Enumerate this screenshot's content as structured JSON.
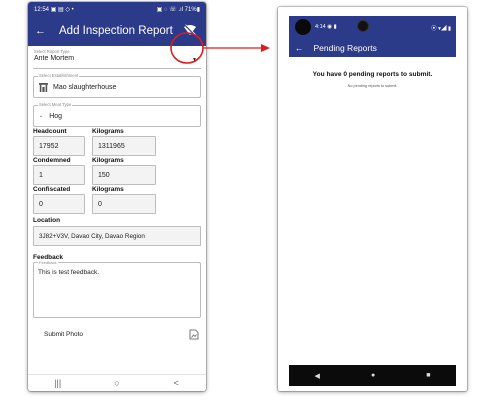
{
  "left_screen": {
    "status_bar": {
      "time": "12:54",
      "icons_left": "▣ ▤ ◇ •",
      "icons_right": "▣ ◌ ☏ .ıl 71%▮"
    },
    "app_bar": {
      "title": "Add Inspection Report",
      "back_icon": "arrow-left-icon",
      "action_icon": "wifi-off-icon"
    },
    "form": {
      "report_type": {
        "label": "Select Report Type",
        "value": "Ante Mortem"
      },
      "establishment": {
        "label": "Select Establishment",
        "value": "Mao slaughterhouse"
      },
      "meat_type": {
        "label": "Select Meat Type",
        "value": "Hog"
      },
      "headcount": {
        "label": "Headcount",
        "value": "17952",
        "kg_label": "Kilograms",
        "kg_value": "1311965"
      },
      "condemned": {
        "label": "Condemned",
        "value": "1",
        "kg_label": "Kilograms",
        "kg_value": "150"
      },
      "confiscated": {
        "label": "Confiscated",
        "value": "0",
        "kg_label": "Kilograms",
        "kg_value": "0"
      },
      "location": {
        "label": "Location",
        "value": "3J82+V3V, Davao City, Davao Region"
      },
      "feedback": {
        "section_label": "Feedback",
        "field_label": "Feedback",
        "value": "This is test feedback."
      },
      "submit_photo": {
        "label": "Submit Photo"
      }
    },
    "nav": {
      "recents": "|||",
      "home": "○",
      "back": "<"
    }
  },
  "annotation": {
    "highlight_color": "#e01b1b"
  },
  "right_screen": {
    "status_bar": {
      "time": "4:14",
      "icons_left": "◉ ▮",
      "icons_right": "⦿ ▾◢ ▮"
    },
    "app_bar": {
      "title": "Pending Reports",
      "back_icon": "arrow-left-icon"
    },
    "message": "You have 0 pending reports to submit.",
    "sub_message": "No pending reports to submit.",
    "nav": {
      "back": "◀",
      "home": "●",
      "recents": "■"
    }
  },
  "colors": {
    "app_bar": "#2c3a8a",
    "annotation": "#e01b1b"
  }
}
